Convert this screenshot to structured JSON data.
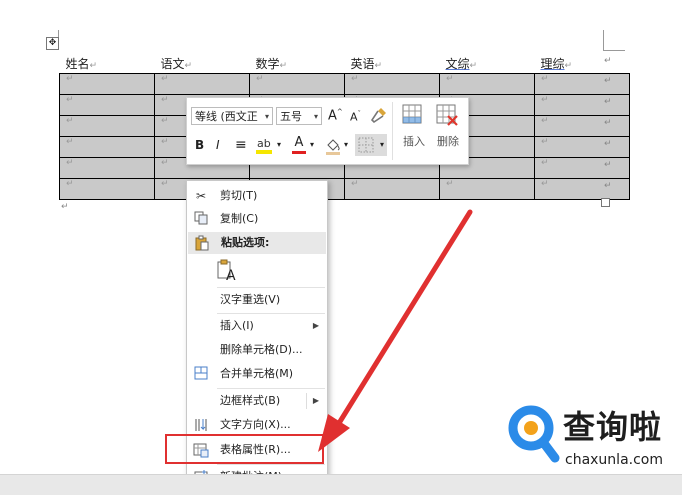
{
  "table": {
    "headers": [
      {
        "label": "姓名"
      },
      {
        "label": "语文"
      },
      {
        "label": "数学"
      },
      {
        "label": "英语"
      },
      {
        "label": "文综"
      },
      {
        "label": "理综"
      }
    ],
    "cell_mark": "↵",
    "row_count": 6
  },
  "doc": {
    "para_mark": "↵",
    "move_handle": "✥"
  },
  "toolbar": {
    "font_name": "等线 (西文正",
    "font_size": "五号",
    "grow_font": "A",
    "shrink_font": "A",
    "bold": "B",
    "italic": "I",
    "align": "≡",
    "font_color_letter": "A",
    "insert_label": "插入",
    "delete_label": "删除",
    "highlight_color": "#f5e600",
    "font_color": "#e02020"
  },
  "context_menu": {
    "items": [
      {
        "label": "剪切(T)",
        "icon": "scissors-icon"
      },
      {
        "label": "复制(C)",
        "icon": "copy-icon"
      },
      {
        "label": "粘贴选项:",
        "icon": "paste-icon"
      },
      {
        "label": "汉字重选(V)"
      },
      {
        "label": "插入(I)"
      },
      {
        "label": "删除单元格(D)..."
      },
      {
        "label": "合并单元格(M)",
        "icon": "merge-cells-icon"
      },
      {
        "label": "边框样式(B)"
      },
      {
        "label": "文字方向(X)...",
        "icon": "text-direction-icon"
      },
      {
        "label": "表格属性(R)...",
        "icon": "table-properties-icon"
      },
      {
        "label": "新建批注(M)",
        "icon": "new-comment-icon"
      }
    ],
    "paste_option_glyph": "A"
  },
  "annotation": {
    "arrow_color": "#e03030",
    "highlight_box_color": "#e03030"
  },
  "watermark": {
    "cn_text": "查询啦",
    "url": "chaxunla.com",
    "brand_color": "#2b8be8"
  }
}
